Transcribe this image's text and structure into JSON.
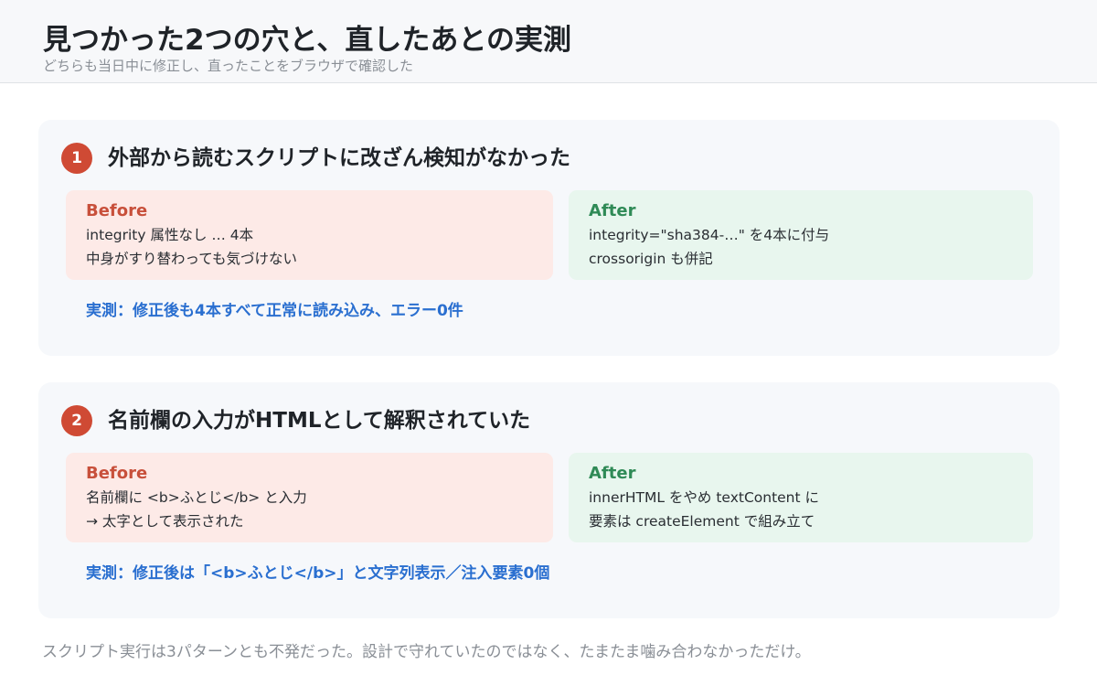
{
  "header": {
    "title": "見つかった2つの穴と、直したあとの実測",
    "subtitle": "どちらも当日中に修正し、直ったことをブラウザで確認した"
  },
  "issues": [
    {
      "number": "1",
      "title": "外部から読むスクリプトに改ざん検知がなかった",
      "before": {
        "label": "Before",
        "lines": [
          "integrity 属性なし … 4本",
          "中身がすり替わっても気づけない"
        ]
      },
      "after": {
        "label": "After",
        "lines": [
          "integrity=\"sha384-…\" を4本に付与",
          "crossorigin も併記"
        ]
      },
      "measure": "実測：修正後も4本すべて正常に読み込み、エラー0件"
    },
    {
      "number": "2",
      "title": "名前欄の入力がHTMLとして解釈されていた",
      "before": {
        "label": "Before",
        "lines": [
          "名前欄に <b>ふとじ</b> と入力",
          "→ 太字として表示された"
        ]
      },
      "after": {
        "label": "After",
        "lines": [
          "innerHTML をやめ textContent に",
          "要素は createElement で組み立て"
        ]
      },
      "measure": "実測：修正後は「<b>ふとじ</b>」と文字列表示／注入要素0個"
    }
  ],
  "footer": {
    "note": "スクリプト実行は3パターンとも不発だった。設計で守れていたのではなく、たまたま噛み合わなかっただけ。"
  },
  "colors": {
    "badge": "#cf4a34",
    "before_bg": "#fdeae7",
    "after_bg": "#e8f6ee",
    "measure_text": "#2a6fd0"
  }
}
